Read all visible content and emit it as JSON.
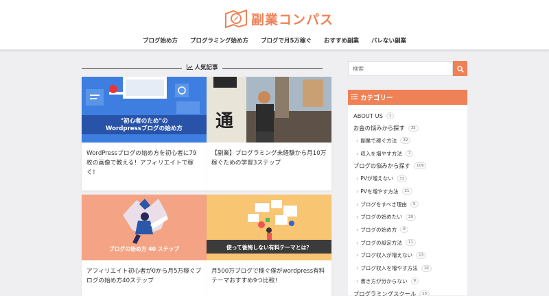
{
  "site": {
    "logo_text": "副業コンパス"
  },
  "nav": [
    "ブログ始め方",
    "プログラミング始め方",
    "ブログで月5万稼ぐ",
    "おすすめ副業",
    "バレない副業"
  ],
  "section": {
    "title": "人気記事"
  },
  "cards": [
    {
      "thumb_caption_1": "\"初心者のため\"の",
      "thumb_caption_2": "Wordpressブログの始め方",
      "title": "WordPressブログの始め方を初心者に79枚の画像で教える！アフィリエイトで稼ぐ！"
    },
    {
      "thumb_text": "通",
      "title": "【副業】プログラミング未経験から月10万稼ぐための学習3ステップ"
    },
    {
      "thumb_caption": "ブログの始め方 40 ステップ",
      "title": "アフィリエイト初心者が0から月5万稼ぐブログの始め方40ステップ"
    },
    {
      "thumb_caption": "使って後悔しない有料テーマとは？",
      "title": "月500万ブログで稼ぐ僕がwordpress有料テーマおすすめ9つ比較！"
    }
  ],
  "search": {
    "placeholder": "検索"
  },
  "categories": {
    "heading": "カテゴリー",
    "items": [
      {
        "label": "ABOUT US",
        "count": "1",
        "sub": false
      },
      {
        "label": "お金の悩みから探す",
        "count": "35",
        "sub": false
      },
      {
        "label": "副業で稼ぐ方法",
        "count": "32",
        "sub": true
      },
      {
        "label": "収入を増やす方法",
        "count": "7",
        "sub": true
      },
      {
        "label": "ブログの悩みから探す",
        "count": "109",
        "sub": false
      },
      {
        "label": "PVが増えない",
        "count": "31",
        "sub": true
      },
      {
        "label": "PVを増やす方法",
        "count": "21",
        "sub": true
      },
      {
        "label": "ブログをすべき理由",
        "count": "5",
        "sub": true
      },
      {
        "label": "ブログの始めたい",
        "count": "29",
        "sub": true
      },
      {
        "label": "ブログの始め方",
        "count": "8",
        "sub": true
      },
      {
        "label": "ブログの設定方法",
        "count": "11",
        "sub": true
      },
      {
        "label": "ブログ収入が増えない",
        "count": "13",
        "sub": true
      },
      {
        "label": "ブログ収入を増やす方法",
        "count": "10",
        "sub": true
      },
      {
        "label": "書き方が分からない",
        "count": "9",
        "sub": true
      },
      {
        "label": "プログラミングスクール",
        "count": "15",
        "sub": false
      }
    ]
  },
  "colors": {
    "accent": "#ef8157",
    "background": "#efeff2"
  }
}
